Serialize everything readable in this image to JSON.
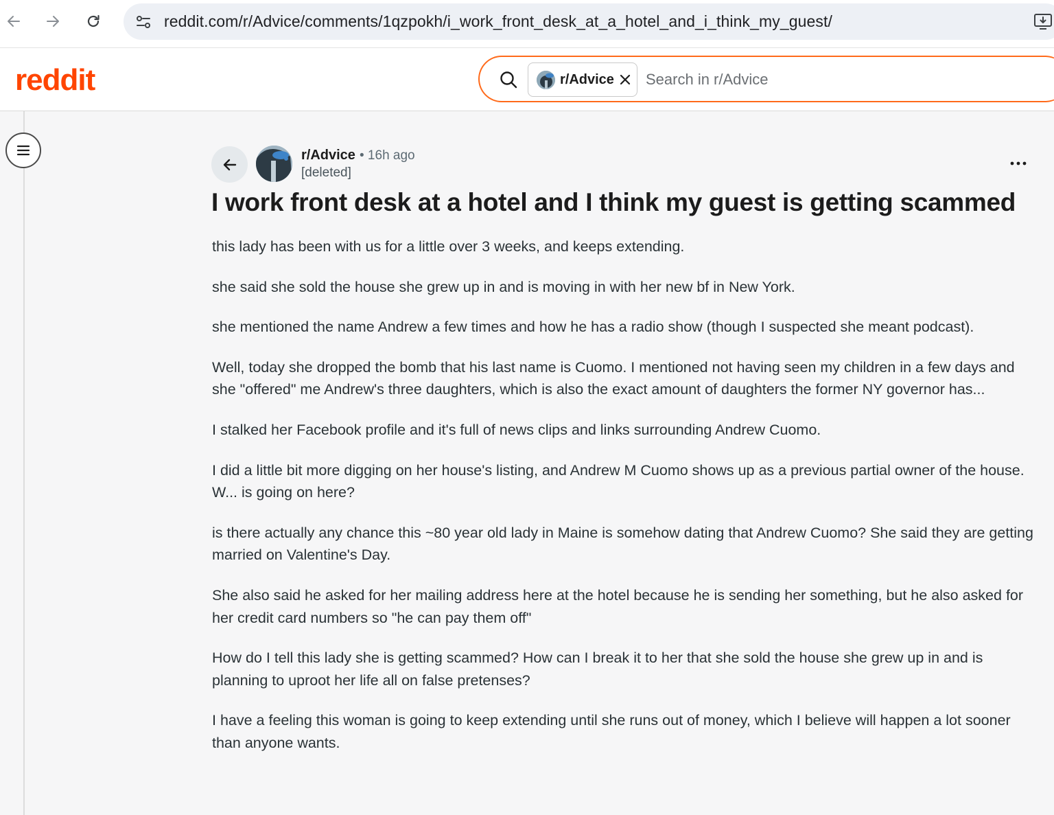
{
  "browser": {
    "url": "reddit.com/r/Advice/comments/1qzpokh/i_work_front_desk_at_a_hotel_and_i_think_my_guest/"
  },
  "header": {
    "logo": "reddit",
    "search": {
      "chip_label": "r/Advice",
      "placeholder": "Search in r/Advice"
    }
  },
  "post": {
    "subreddit": "r/Advice",
    "time": "• 16h ago",
    "author": "[deleted]",
    "title": "I work front desk at a hotel and I think my guest is getting scammed",
    "paragraphs": [
      "this lady has been with us for a little over 3 weeks, and keeps extending.",
      "she said she sold the house she grew up in and is moving in with her new bf in New York.",
      "she mentioned the name Andrew a few times and how he has a radio show (though I suspected she meant podcast).",
      "Well, today she dropped the bomb that his last name is Cuomo. I mentioned not having seen my children in a few days and she \"offered\" me Andrew's three daughters, which is also the exact amount of daughters the former NY governor has...",
      "I stalked her Facebook profile and it's full of news clips and links surrounding Andrew Cuomo.",
      "I did a little bit more digging on her house's listing, and Andrew M Cuomo shows up as a previous partial owner of the house. W... is going on here?",
      "is there actually any chance this ~80 year old lady in Maine is somehow dating that Andrew Cuomo? She said they are getting married on Valentine's Day.",
      "She also said he asked for her mailing address here at the hotel because he is sending her something, but he also asked for her credit card numbers so \"he can pay them off\"",
      "How do I tell this lady she is getting scammed? How can I break it to her that she sold the house she grew up in and is planning to uproot her life all on false pretenses?",
      "I have a feeling this woman is going to keep extending until she runs out of money, which I believe will happen a lot sooner than anyone wants."
    ]
  },
  "colors": {
    "brand": "#ff4500",
    "search_border": "#ff6a1a",
    "page_bg": "#f6f6f7"
  },
  "icons": [
    "back-arrow-icon",
    "forward-arrow-icon",
    "reload-icon",
    "site-info-icon",
    "install-app-icon",
    "search-icon",
    "close-icon",
    "menu-icon",
    "back-icon",
    "more-options-icon"
  ]
}
